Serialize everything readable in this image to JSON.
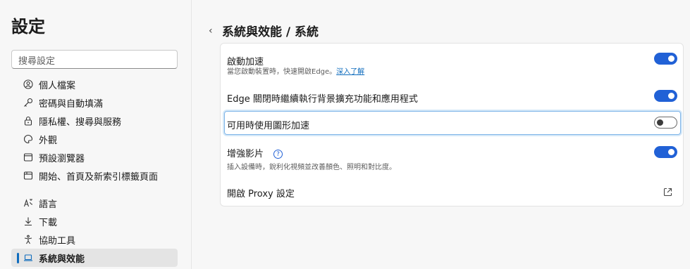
{
  "sidebar": {
    "title": "設定",
    "search_placeholder": "搜尋設定",
    "items": [
      {
        "label": "個人檔案",
        "icon": "profile-icon"
      },
      {
        "label": "密碼與自動填滿",
        "icon": "key-icon"
      },
      {
        "label": "隱私權、搜尋與服務",
        "icon": "lock-icon"
      },
      {
        "label": "外觀",
        "icon": "palette-icon"
      },
      {
        "label": "預設瀏覽器",
        "icon": "browser-icon"
      },
      {
        "label": "開始、首頁及新索引標籤頁面",
        "icon": "home-tab-icon"
      },
      {
        "label": "語言",
        "icon": "language-icon"
      },
      {
        "label": "下載",
        "icon": "download-icon"
      },
      {
        "label": "協助工具",
        "icon": "accessibility-icon"
      },
      {
        "label": "系統與效能",
        "icon": "laptop-icon",
        "active": true
      }
    ]
  },
  "header": {
    "back_label": "‹",
    "title": "系統與效能 / 系統"
  },
  "settings": {
    "startup_boost": {
      "label": "啟動加速",
      "description": "當您啟動裝置時，快速開啟Edge。",
      "learn_more": "深入了解",
      "enabled": true
    },
    "background_apps": {
      "label": "Edge 關閉時繼續執行背景擴充功能和應用程式",
      "enabled": true
    },
    "hardware_accel": {
      "label": "可用時使用圖形加速",
      "enabled": false
    },
    "enhance_video": {
      "label": "增強影片",
      "help": "?",
      "description": "插入設備時，銳利化視頻並改善顏色、照明和對比度。",
      "enabled": true
    },
    "proxy": {
      "label": "開啟 Proxy 設定"
    }
  },
  "colors": {
    "accent": "#2161d6",
    "link": "#0f6cbd"
  }
}
